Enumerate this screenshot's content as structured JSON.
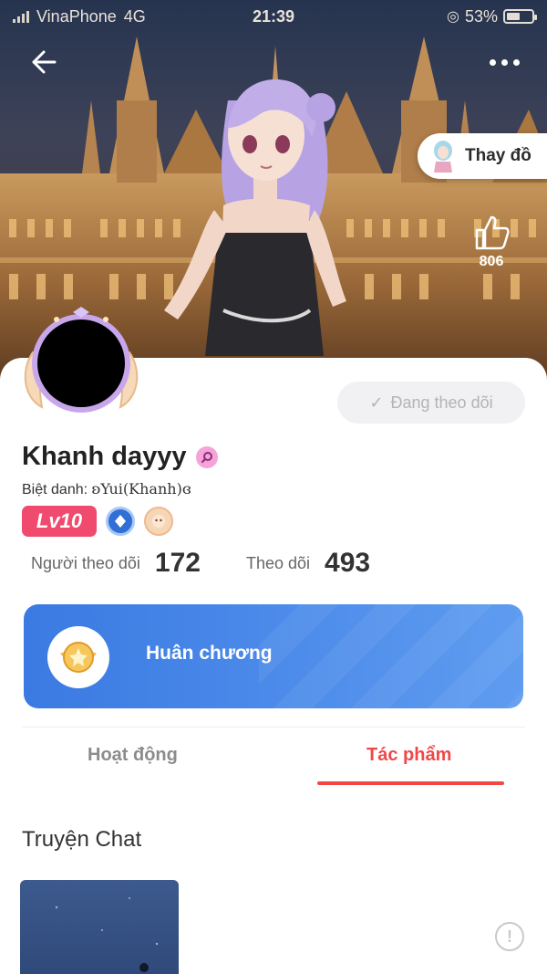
{
  "status_bar": {
    "carrier": "VinaPhone",
    "network": "4G",
    "time": "21:39",
    "battery": "53%",
    "battery_level": 0.53
  },
  "header": {
    "back_icon": "arrow-left-icon",
    "more_icon": "more-dots-icon",
    "change_outfit_label": "Thay đồ",
    "like_count": "806"
  },
  "profile": {
    "name": "Khanh dayyy",
    "nickname_label": "Biệt danh:",
    "nickname_value": "ʚYui(Khanh)ɞ",
    "level": "Lv10",
    "follow_button_label": "Đang theo dõi",
    "followers_label": "Người theo dõi",
    "followers_count": "172",
    "following_label": "Theo dõi",
    "following_count": "493"
  },
  "medal": {
    "title": "Huân chương"
  },
  "tabs": [
    {
      "label": "Hoạt động",
      "active": false
    },
    {
      "label": "Tác phẩm",
      "active": true
    }
  ],
  "works": {
    "section_title": "Truyện Chat"
  },
  "colors": {
    "accent_red": "#f04848",
    "level_pink": "#f04a6e",
    "medal_blue": "#3a7ae2"
  }
}
